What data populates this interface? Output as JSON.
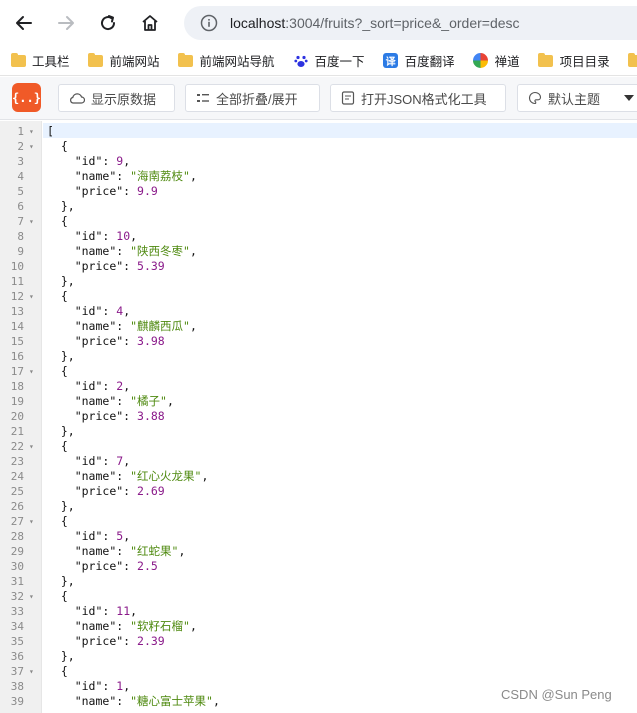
{
  "browser": {
    "url_host": "localhost",
    "url_rest": ":3004/fruits?_sort=price&_order=desc",
    "nav_icons": [
      "back-arrow-icon",
      "forward-arrow-icon",
      "reload-icon",
      "home-icon",
      "info-icon"
    ]
  },
  "bookmarks": [
    {
      "label": "工具栏",
      "icon": "folder-icon"
    },
    {
      "label": "前端网站",
      "icon": "folder-icon"
    },
    {
      "label": "前端网站导航",
      "icon": "folder-icon"
    },
    {
      "label": "百度一下",
      "icon": "baidu-paw-icon"
    },
    {
      "label": "百度翻译",
      "icon": "baidu-translate-icon"
    },
    {
      "label": "禅道",
      "icon": "zentao-icon"
    },
    {
      "label": "项目目录",
      "icon": "folder-icon"
    },
    {
      "label": "",
      "icon": "folder-icon"
    }
  ],
  "toolbar": {
    "logo_text": "{..}",
    "raw_label": "显示原数据",
    "fold_label": "全部折叠/展开",
    "format_label": "打开JSON格式化工具",
    "theme_label": "默认主题",
    "accent": "#f05a28"
  },
  "json_lines": [
    {
      "n": "1",
      "fold": true,
      "text": "["
    },
    {
      "n": "2",
      "fold": true,
      "text": "  {"
    },
    {
      "n": "3",
      "fold": false,
      "key": "id",
      "value": "9",
      "vtype": "num",
      "comma": true
    },
    {
      "n": "4",
      "fold": false,
      "key": "name",
      "value": "海南荔枝",
      "vtype": "str",
      "comma": true
    },
    {
      "n": "5",
      "fold": false,
      "key": "price",
      "value": "9.9",
      "vtype": "num",
      "comma": false
    },
    {
      "n": "6",
      "fold": false,
      "text": "  },"
    },
    {
      "n": "7",
      "fold": true,
      "text": "  {"
    },
    {
      "n": "8",
      "fold": false,
      "key": "id",
      "value": "10",
      "vtype": "num",
      "comma": true
    },
    {
      "n": "9",
      "fold": false,
      "key": "name",
      "value": "陕西冬枣",
      "vtype": "str",
      "comma": true
    },
    {
      "n": "10",
      "fold": false,
      "key": "price",
      "value": "5.39",
      "vtype": "num",
      "comma": false
    },
    {
      "n": "11",
      "fold": false,
      "text": "  },"
    },
    {
      "n": "12",
      "fold": true,
      "text": "  {"
    },
    {
      "n": "13",
      "fold": false,
      "key": "id",
      "value": "4",
      "vtype": "num",
      "comma": true
    },
    {
      "n": "14",
      "fold": false,
      "key": "name",
      "value": "麒麟西瓜",
      "vtype": "str",
      "comma": true
    },
    {
      "n": "15",
      "fold": false,
      "key": "price",
      "value": "3.98",
      "vtype": "num",
      "comma": false
    },
    {
      "n": "16",
      "fold": false,
      "text": "  },"
    },
    {
      "n": "17",
      "fold": true,
      "text": "  {"
    },
    {
      "n": "18",
      "fold": false,
      "key": "id",
      "value": "2",
      "vtype": "num",
      "comma": true
    },
    {
      "n": "19",
      "fold": false,
      "key": "name",
      "value": "橘子",
      "vtype": "str",
      "comma": true
    },
    {
      "n": "20",
      "fold": false,
      "key": "price",
      "value": "3.88",
      "vtype": "num",
      "comma": false
    },
    {
      "n": "21",
      "fold": false,
      "text": "  },"
    },
    {
      "n": "22",
      "fold": true,
      "text": "  {"
    },
    {
      "n": "23",
      "fold": false,
      "key": "id",
      "value": "7",
      "vtype": "num",
      "comma": true
    },
    {
      "n": "24",
      "fold": false,
      "key": "name",
      "value": "红心火龙果",
      "vtype": "str",
      "comma": true
    },
    {
      "n": "25",
      "fold": false,
      "key": "price",
      "value": "2.69",
      "vtype": "num",
      "comma": false
    },
    {
      "n": "26",
      "fold": false,
      "text": "  },"
    },
    {
      "n": "27",
      "fold": true,
      "text": "  {"
    },
    {
      "n": "28",
      "fold": false,
      "key": "id",
      "value": "5",
      "vtype": "num",
      "comma": true
    },
    {
      "n": "29",
      "fold": false,
      "key": "name",
      "value": "红蛇果",
      "vtype": "str",
      "comma": true
    },
    {
      "n": "30",
      "fold": false,
      "key": "price",
      "value": "2.5",
      "vtype": "num",
      "comma": false
    },
    {
      "n": "31",
      "fold": false,
      "text": "  },"
    },
    {
      "n": "32",
      "fold": true,
      "text": "  {"
    },
    {
      "n": "33",
      "fold": false,
      "key": "id",
      "value": "11",
      "vtype": "num",
      "comma": true
    },
    {
      "n": "34",
      "fold": false,
      "key": "name",
      "value": "软籽石榴",
      "vtype": "str",
      "comma": true
    },
    {
      "n": "35",
      "fold": false,
      "key": "price",
      "value": "2.39",
      "vtype": "num",
      "comma": false
    },
    {
      "n": "36",
      "fold": false,
      "text": "  },"
    },
    {
      "n": "37",
      "fold": true,
      "text": "  {"
    },
    {
      "n": "38",
      "fold": false,
      "key": "id",
      "value": "1",
      "vtype": "num",
      "comma": true
    },
    {
      "n": "39",
      "fold": false,
      "key": "name",
      "value": "糖心富士苹果",
      "vtype": "str",
      "comma": true
    }
  ],
  "watermark": "CSDN @Sun  Peng",
  "colors": {
    "string": "#4f8a10",
    "number": "#8a1a8a",
    "active_line": "#e8f2ff"
  }
}
